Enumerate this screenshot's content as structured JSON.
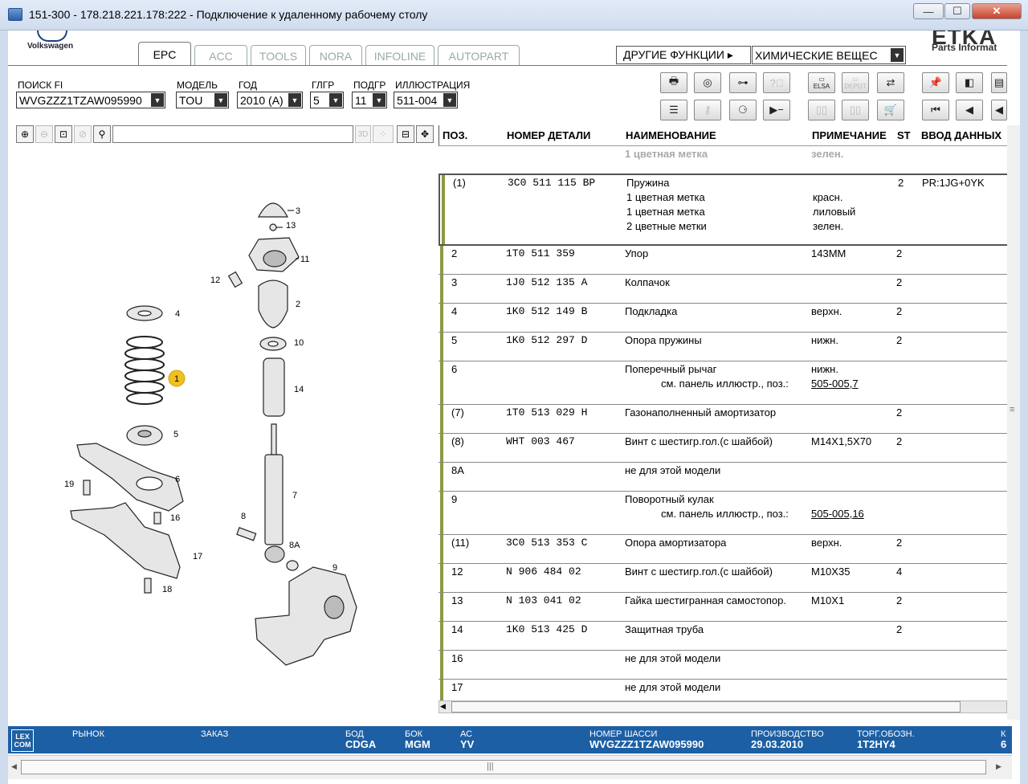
{
  "window": {
    "title": "151-300 - 178.218.221.178:222 - Подключение к удаленному рабочему столу",
    "minimize": "—",
    "maximize": "☐",
    "close": "✕"
  },
  "brand": {
    "vw": "Volkswagen",
    "etka": "ETKA",
    "etka_sub": "Parts Informat"
  },
  "tabs": [
    "EPC",
    "ACC",
    "TOOLS",
    "NORA",
    "INFOLINE",
    "AUTOPART"
  ],
  "other_functions": "ДРУГИЕ ФУНКЦИИ ▸",
  "chem": "ХИМИЧЕСКИЕ ВЕЩЕС",
  "fields": {
    "fi_label": "ПОИСК FI",
    "fi_value": "WVGZZZ1TZAW095990",
    "model_label": "МОДЕЛЬ",
    "model_value": "TOU",
    "year_label": "ГОД",
    "year_value": "2010 (A)",
    "mg_label": "ГЛГР",
    "mg_value": "5",
    "sg_label": "ПОДГР",
    "sg_value": "11",
    "ill_label": "ИЛЛЮСТРАЦИЯ",
    "ill_value": "511-004"
  },
  "toolbar_icons": [
    "print-icon",
    "speedometer-icon",
    "binoculars-icon",
    "help-icon",
    "elsa-icon",
    "depot-icon",
    "cart-transfer-icon",
    "pin-icon",
    "page-back-icon",
    "page-icon",
    "list-icon",
    "key-icon",
    "bike-icon",
    "arrow-minus-icon",
    "device-icon",
    "device-compare-icon",
    "cart-icon",
    "first-icon",
    "previous-icon",
    "back-icon"
  ],
  "toolbar_labels": {
    "elsa": "ELSA",
    "depot": "DEPOT"
  },
  "zoom": {
    "btn3d": "3D"
  },
  "table": {
    "headers": {
      "pos": "ПОЗ.",
      "part": "НОМЕР ДЕТАЛИ",
      "name": "НАИМЕНОВАНИЕ",
      "note": "ПРИМЕЧАНИЕ",
      "st": "ST",
      "input": "ВВОД ДАННЫХ"
    },
    "pre_row": {
      "name": "1 цветная метка",
      "note": "зелен."
    },
    "rows": [
      {
        "pos": "(1)",
        "part": "3C0  511  115  BP",
        "lines": [
          {
            "name": "Пружина",
            "note": "",
            "st": "2",
            "input": "PR:1JG+0YK"
          },
          {
            "name": "1 цветная метка",
            "note": "красн."
          },
          {
            "name": "1 цветная метка",
            "note": "лиловый"
          },
          {
            "name": "2 цветные метки",
            "note": "зелен."
          }
        ]
      },
      {
        "pos": "2",
        "part": "1T0  511  359",
        "lines": [
          {
            "name": "Упор",
            "note": "143MM",
            "st": "2"
          }
        ]
      },
      {
        "pos": "3",
        "part": "1J0  512  135  A",
        "lines": [
          {
            "name": "Колпачок",
            "note": "",
            "st": "2"
          }
        ]
      },
      {
        "pos": "4",
        "part": "1K0  512  149  B",
        "lines": [
          {
            "name": "Подкладка",
            "note": "верхн.",
            "st": "2"
          }
        ]
      },
      {
        "pos": "5",
        "part": "1K0  512  297  D",
        "lines": [
          {
            "name": "Опора пружины",
            "note": "нижн.",
            "st": "2"
          }
        ]
      },
      {
        "pos": "6",
        "part": "",
        "lines": [
          {
            "name": "Поперечный рычаг",
            "note": "нижн."
          },
          {
            "name": "см. панель иллюстр., поз.:",
            "note": "505-005,7",
            "indent": true,
            "link": true
          }
        ]
      },
      {
        "pos": "(7)",
        "part": "1T0  513  029  H",
        "lines": [
          {
            "name": "Газонаполненный амортизатор",
            "note": "",
            "st": "2"
          }
        ]
      },
      {
        "pos": "(8)",
        "part": "WHT  003  467",
        "lines": [
          {
            "name": "Винт с шестигр.гол.(с шайбой)",
            "note": "M14X1,5X70",
            "st": "2"
          }
        ]
      },
      {
        "pos": "8A",
        "part": "",
        "lines": [
          {
            "name": "не для этой модели",
            "note": ""
          }
        ]
      },
      {
        "pos": "9",
        "part": "",
        "lines": [
          {
            "name": "Поворотный кулак",
            "note": ""
          },
          {
            "name": "см. панель иллюстр., поз.:",
            "note": "505-005,16",
            "indent": true,
            "link": true
          }
        ]
      },
      {
        "pos": "(11)",
        "part": "3C0  513  353  C",
        "lines": [
          {
            "name": "Опора амортизатора",
            "note": "верхн.",
            "st": "2"
          }
        ]
      },
      {
        "pos": "12",
        "part": "N    906  484  02",
        "lines": [
          {
            "name": "Винт с шестигр.гол.(с шайбой)",
            "note": "M10X35",
            "st": "4"
          }
        ]
      },
      {
        "pos": "13",
        "part": "N    103  041  02",
        "lines": [
          {
            "name": "Гайка шестигранная самостопор.",
            "note": "M10X1",
            "st": "2"
          }
        ]
      },
      {
        "pos": "14",
        "part": "1K0  513  425  D",
        "lines": [
          {
            "name": "Защитная труба",
            "note": "",
            "st": "2"
          }
        ]
      },
      {
        "pos": "16",
        "part": "",
        "lines": [
          {
            "name": "не для этой модели",
            "note": ""
          }
        ]
      },
      {
        "pos": "17",
        "part": "",
        "lines": [
          {
            "name": "не для этой модели",
            "note": ""
          }
        ]
      }
    ]
  },
  "status": {
    "logo": "LEX COM",
    "market_label": "РЫНОК",
    "order_label": "ЗАКАЗ",
    "bod_label": "БОД",
    "bod_value": "CDGA",
    "bok_label": "БОК",
    "bok_value": "MGM",
    "ac_label": "АС",
    "ac_value": "YV",
    "chassis_label": "НОМЕР ШАССИ",
    "chassis_value": "WVGZZZ1TZAW095990",
    "prod_label": "ПРОИЗВОДСТВО",
    "prod_value": "29.03.2010",
    "trade_label": "ТОРГ.ОБОЗН.",
    "trade_value": "1T2HY4",
    "k_label": "К",
    "k_value": "6"
  },
  "illustration": {
    "callouts": [
      "3",
      "13",
      "11",
      "12",
      "2",
      "4",
      "10",
      "1",
      "14",
      "5",
      "6",
      "19",
      "7",
      "16",
      "17",
      "18",
      "8",
      "8A",
      "9"
    ],
    "highlight_color": "#f0c020"
  }
}
